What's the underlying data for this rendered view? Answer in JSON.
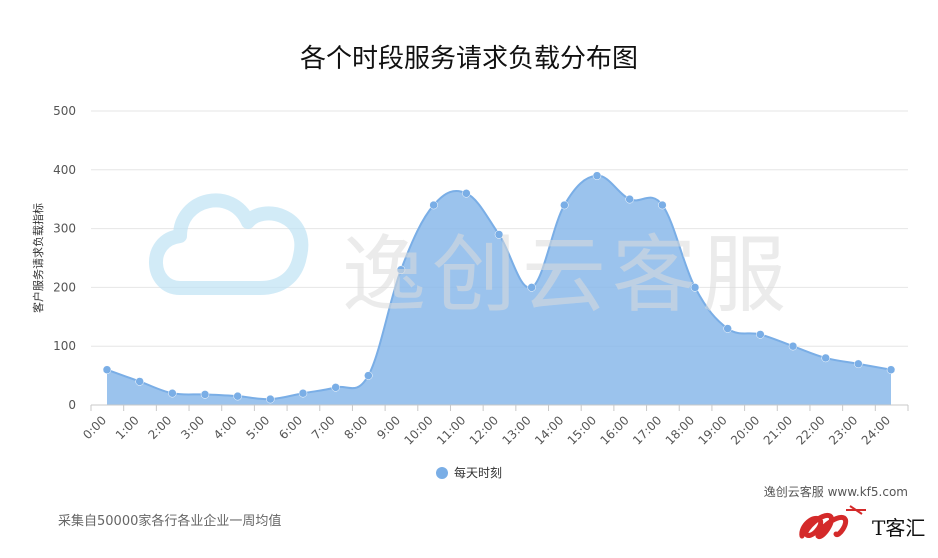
{
  "title": "各个时段服务请求负载分布图",
  "watermark": "逸创云客服",
  "credit": "逸创云客服 www.kf5.com",
  "footnote": "采集自50000家各行各业企业一周均值",
  "brand": "T客汇",
  "colors": {
    "area": "#8ab8ea",
    "line": "#7aaee6",
    "marker": "#7aaee6",
    "grid": "#e6e6e6",
    "watermark_icon": "#bfe3f5",
    "brand_red": "#d42a2a"
  },
  "chart_data": {
    "type": "area",
    "title": "各个时段服务请求负载分布图",
    "xlabel": "",
    "ylabel": "客户服务请求负载指标",
    "ylim": [
      0,
      500
    ],
    "yticks": [
      0,
      100,
      200,
      300,
      400,
      500
    ],
    "legend_position": "bottom",
    "grid": true,
    "categories": [
      "0:00",
      "1:00",
      "2:00",
      "3:00",
      "4:00",
      "5:00",
      "6:00",
      "7:00",
      "8:00",
      "9:00",
      "10:00",
      "11:00",
      "12:00",
      "13:00",
      "14:00",
      "15:00",
      "16:00",
      "17:00",
      "18:00",
      "19:00",
      "20:00",
      "21:00",
      "22:00",
      "23:00",
      "24:00"
    ],
    "series": [
      {
        "name": "每天时刻",
        "values": [
          60,
          40,
          20,
          18,
          15,
          10,
          20,
          30,
          50,
          230,
          340,
          360,
          290,
          200,
          340,
          390,
          350,
          340,
          200,
          130,
          120,
          100,
          80,
          70,
          60
        ]
      }
    ]
  }
}
